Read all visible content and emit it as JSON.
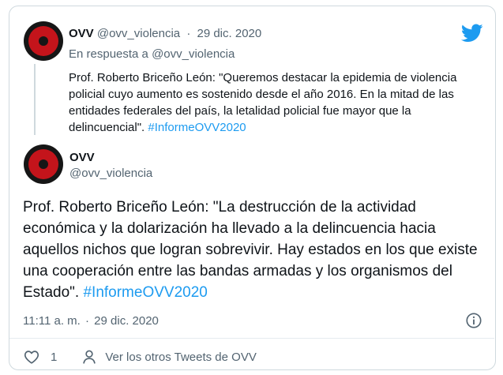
{
  "quoted": {
    "name": "OVV",
    "handle": "@ovv_violencia",
    "separator": "·",
    "date": "29 dic. 2020",
    "reply_to": "En respuesta a @ovv_violencia",
    "text": "Prof. Roberto Briceño León: \"Queremos destacar la epidemia de violencia policial cuyo aumento es sostenido desde el año 2016. En la mitad de las entidades federales del país, la letalidad policial fue mayor que la delincuencial\". ",
    "hashtag": "#InformeOVV2020"
  },
  "main": {
    "name": "OVV",
    "handle": "@ovv_violencia",
    "text": "Prof. Roberto Briceño León: \"La destrucción de la actividad económica y la dolarización ha llevado a la delincuencia hacia aquellos nichos que logran sobrevivir. Hay estados en los que existe una cooperación entre las bandas armadas y los organismos del Estado\". ",
    "hashtag": "#InformeOVV2020",
    "time": "11:11 a. m.",
    "separator": "·",
    "date": "29 dic. 2020"
  },
  "actions": {
    "like_count": "1",
    "more_tweets_label": "Ver los otros Tweets de OVV"
  },
  "icons": {
    "logo": "twitter-bird-icon",
    "info": "info-icon",
    "like": "heart-icon",
    "profile": "person-icon"
  },
  "colors": {
    "link": "#1d9bf0",
    "muted": "#536471",
    "avatar_red": "#c4141b",
    "avatar_dark": "#161616",
    "border": "#cfd9de"
  }
}
